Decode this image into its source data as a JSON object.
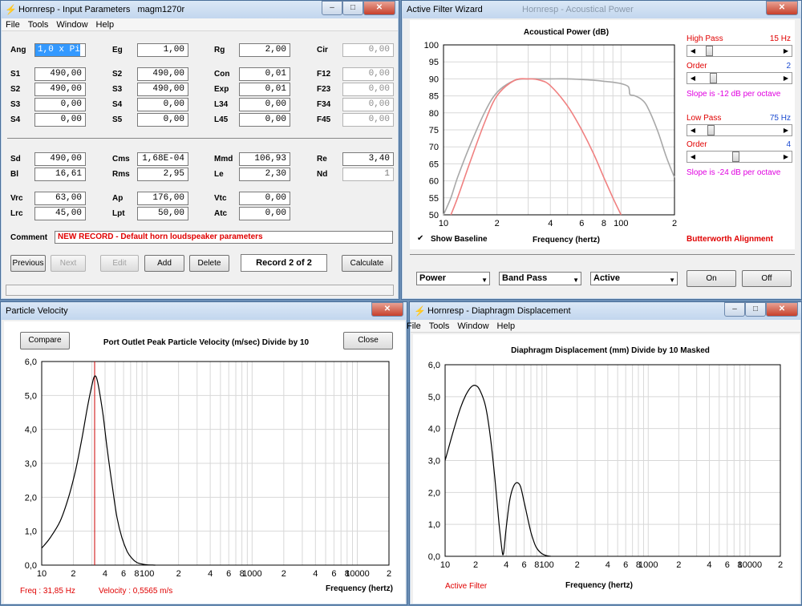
{
  "input_params": {
    "title": "Hornresp - Input Parameters",
    "record_name": "magm1270r",
    "menu": [
      "File",
      "Tools",
      "Window",
      "Help"
    ],
    "rows": [
      {
        "l1": "Ang",
        "v1": "1,0 x Pi",
        "l2": "Eg",
        "v2": "1,00",
        "l3": "Rg",
        "v3": "2,00",
        "l4": "Cir",
        "v4": "0,00"
      },
      {
        "l1": "S1",
        "v1": "490,00",
        "l2": "S2",
        "v2": "490,00",
        "l3": "Con",
        "v3": "0,01",
        "l4": "F12",
        "v4": "0,00"
      },
      {
        "l1": "S2",
        "v1": "490,00",
        "l2": "S3",
        "v2": "490,00",
        "l3": "Exp",
        "v3": "0,01",
        "l4": "F23",
        "v4": "0,00"
      },
      {
        "l1": "S3",
        "v1": "0,00",
        "l2": "S4",
        "v2": "0,00",
        "l3": "L34",
        "v3": "0,00",
        "l4": "F34",
        "v4": "0,00"
      },
      {
        "l1": "S4",
        "v1": "0,00",
        "l2": "S5",
        "v2": "0,00",
        "l3": "L45",
        "v3": "0,00",
        "l4": "F45",
        "v4": "0,00"
      },
      {
        "l1": "Sd",
        "v1": "490,00",
        "l2": "Cms",
        "v2": "1,68E-04",
        "l3": "Mmd",
        "v3": "106,93",
        "l4": "Re",
        "v4": "3,40"
      },
      {
        "l1": "Bl",
        "v1": "16,61",
        "l2": "Rms",
        "v2": "2,95",
        "l3": "Le",
        "v3": "2,30",
        "l4": "Nd",
        "v4": "1"
      },
      {
        "l1": "Vrc",
        "v1": "63,00",
        "l2": "Ap",
        "v2": "176,00",
        "l3": "Vtc",
        "v3": "0,00"
      },
      {
        "l1": "Lrc",
        "v1": "45,00",
        "l2": "Lpt",
        "v2": "50,00",
        "l3": "Atc",
        "v3": "0,00"
      }
    ],
    "comment_label": "Comment",
    "comment": "NEW RECORD - Default horn loudspeaker parameters",
    "buttons": {
      "previous": "Previous",
      "next": "Next",
      "edit": "Edit",
      "add": "Add",
      "delete": "Delete",
      "calculate": "Calculate"
    },
    "record_status": "Record 2 of 2"
  },
  "filter_wizard": {
    "title": "Active Filter Wizard",
    "behind_title": "Hornresp - Acoustical Power",
    "high_pass_label": "High Pass",
    "high_pass_value": "15 Hz",
    "hp_order_label": "Order",
    "hp_order_value": "2",
    "hp_slope": "Slope is -12 dB per octave",
    "low_pass_label": "Low Pass",
    "low_pass_value": "75 Hz",
    "lp_order_label": "Order",
    "lp_order_value": "4",
    "lp_slope": "Slope is -24 dB per octave",
    "hp_level": 0.1,
    "hp_order_level": 0.15,
    "lp_level": 0.12,
    "lp_order_level": 0.45,
    "show_baseline_label": "Show Baseline",
    "show_baseline_checked": true,
    "alignment": "Butterworth Alignment",
    "select_type": "Power",
    "select_mode": "Band Pass",
    "select_state": "Active",
    "on_label": "On",
    "off_label": "Off"
  },
  "particle_velocity": {
    "title": "Particle Velocity",
    "compare_label": "Compare",
    "close_label": "Close",
    "readout_freq": "Freq : 31,85 Hz",
    "readout_velocity": "Velocity : 0,5565 m/s"
  },
  "diaphragm": {
    "title": "Hornresp - Diaphragm Displacement",
    "menu": [
      "File",
      "Tools",
      "Window",
      "Help"
    ],
    "annotation": "Active Filter"
  },
  "chart_data": [
    {
      "type": "line",
      "title": "Acoustical Power (dB)",
      "xlabel": "Frequency (hertz)",
      "x_scale": "log",
      "xlim": [
        10,
        200
      ],
      "ylim": [
        50,
        100
      ],
      "x_ticks": [
        "10",
        "2",
        "4",
        "6",
        "8",
        "100",
        "2"
      ],
      "y_ticks": [
        "100",
        "95",
        "90",
        "85",
        "80",
        "75",
        "70",
        "65",
        "60",
        "55",
        "50"
      ],
      "grid": true,
      "series": [
        {
          "color": "#a8a8a8",
          "x": [
            10,
            11,
            12,
            14,
            17,
            20,
            25,
            30,
            35,
            40,
            50,
            60,
            70,
            80,
            90,
            100,
            110,
            112,
            115,
            120,
            130,
            140,
            160,
            180,
            200
          ],
          "y": [
            50,
            55,
            61,
            70,
            80,
            86,
            89.5,
            90,
            90,
            90,
            90,
            89.8,
            89.6,
            89.3,
            89,
            88.6,
            87.7,
            85.5,
            85.2,
            85,
            84,
            82,
            75,
            67,
            61
          ]
        },
        {
          "color": "#f08080",
          "x": [
            11,
            12,
            14,
            17,
            20,
            25,
            30,
            35,
            40,
            50,
            60,
            70,
            80,
            90,
            100
          ],
          "y": [
            50,
            55,
            65,
            77,
            85,
            89.5,
            90,
            89.6,
            88,
            82,
            75,
            68,
            61,
            55,
            50
          ]
        }
      ]
    },
    {
      "type": "line",
      "title": "Port Outlet Peak Particle Velocity (m/sec)   Divide by 10",
      "xlabel": "Frequency (hertz)",
      "x_scale": "log",
      "xlim": [
        10,
        20000
      ],
      "ylim": [
        0,
        6
      ],
      "x_ticks": [
        "10",
        "2",
        "4",
        "6",
        "8",
        "100",
        "2",
        "4",
        "6",
        "8",
        "1000",
        "2",
        "4",
        "6",
        "8",
        "10000",
        "2"
      ],
      "y_ticks": [
        "6,0",
        "5,0",
        "4,0",
        "3,0",
        "2,0",
        "1,0",
        "0,0"
      ],
      "grid": true,
      "marker_x": 31.85,
      "series": [
        {
          "color": "#000000",
          "x": [
            10,
            12,
            15,
            18,
            21,
            24,
            27,
            30,
            31.85,
            34,
            38,
            42,
            47,
            52,
            58,
            65,
            72,
            80,
            90,
            100,
            120
          ],
          "y": [
            0.5,
            0.8,
            1.3,
            2.0,
            2.8,
            3.7,
            4.6,
            5.3,
            5.57,
            5.4,
            4.5,
            3.4,
            2.3,
            1.4,
            0.8,
            0.4,
            0.2,
            0.08,
            0.03,
            0.01,
            0
          ]
        }
      ]
    },
    {
      "type": "line",
      "title": "Diaphragm Displacement (mm)   Divide by 10   Masked",
      "xlabel": "Frequency (hertz)",
      "x_scale": "log",
      "xlim": [
        10,
        20000
      ],
      "ylim": [
        0,
        6
      ],
      "x_ticks": [
        "10",
        "2",
        "4",
        "6",
        "8",
        "100",
        "2",
        "4",
        "6",
        "8",
        "1000",
        "2",
        "4",
        "6",
        "8",
        "10000",
        "2"
      ],
      "y_ticks": [
        "6,0",
        "5,0",
        "4,0",
        "3,0",
        "2,0",
        "1,0",
        "0,0"
      ],
      "grid": true,
      "series": [
        {
          "color": "#000000",
          "x": [
            10,
            12,
            14,
            16,
            18,
            20,
            22,
            25,
            28,
            31,
            34,
            36,
            37,
            38,
            40,
            43,
            46,
            50,
            55,
            60,
            65,
            70,
            75,
            80,
            90,
            100,
            110
          ],
          "y": [
            3.0,
            3.9,
            4.6,
            5.05,
            5.3,
            5.35,
            5.2,
            4.7,
            3.7,
            2.4,
            1.0,
            0.3,
            0.05,
            0.2,
            0.9,
            1.7,
            2.1,
            2.3,
            2.2,
            1.7,
            1.2,
            0.75,
            0.45,
            0.25,
            0.08,
            0.02,
            0
          ]
        }
      ]
    }
  ]
}
